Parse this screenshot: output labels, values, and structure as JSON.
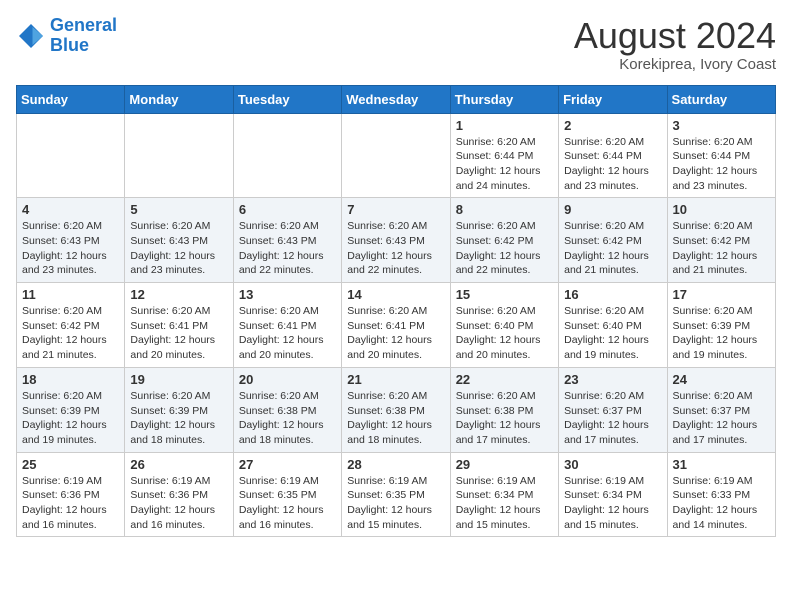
{
  "header": {
    "logo_line1": "General",
    "logo_line2": "Blue",
    "title": "August 2024",
    "subtitle": "Korekiprea, Ivory Coast"
  },
  "weekdays": [
    "Sunday",
    "Monday",
    "Tuesday",
    "Wednesday",
    "Thursday",
    "Friday",
    "Saturday"
  ],
  "weeks": [
    [
      {
        "day": "",
        "info": ""
      },
      {
        "day": "",
        "info": ""
      },
      {
        "day": "",
        "info": ""
      },
      {
        "day": "",
        "info": ""
      },
      {
        "day": "1",
        "info": "Sunrise: 6:20 AM\nSunset: 6:44 PM\nDaylight: 12 hours\nand 24 minutes."
      },
      {
        "day": "2",
        "info": "Sunrise: 6:20 AM\nSunset: 6:44 PM\nDaylight: 12 hours\nand 23 minutes."
      },
      {
        "day": "3",
        "info": "Sunrise: 6:20 AM\nSunset: 6:44 PM\nDaylight: 12 hours\nand 23 minutes."
      }
    ],
    [
      {
        "day": "4",
        "info": "Sunrise: 6:20 AM\nSunset: 6:43 PM\nDaylight: 12 hours\nand 23 minutes."
      },
      {
        "day": "5",
        "info": "Sunrise: 6:20 AM\nSunset: 6:43 PM\nDaylight: 12 hours\nand 23 minutes."
      },
      {
        "day": "6",
        "info": "Sunrise: 6:20 AM\nSunset: 6:43 PM\nDaylight: 12 hours\nand 22 minutes."
      },
      {
        "day": "7",
        "info": "Sunrise: 6:20 AM\nSunset: 6:43 PM\nDaylight: 12 hours\nand 22 minutes."
      },
      {
        "day": "8",
        "info": "Sunrise: 6:20 AM\nSunset: 6:42 PM\nDaylight: 12 hours\nand 22 minutes."
      },
      {
        "day": "9",
        "info": "Sunrise: 6:20 AM\nSunset: 6:42 PM\nDaylight: 12 hours\nand 21 minutes."
      },
      {
        "day": "10",
        "info": "Sunrise: 6:20 AM\nSunset: 6:42 PM\nDaylight: 12 hours\nand 21 minutes."
      }
    ],
    [
      {
        "day": "11",
        "info": "Sunrise: 6:20 AM\nSunset: 6:42 PM\nDaylight: 12 hours\nand 21 minutes."
      },
      {
        "day": "12",
        "info": "Sunrise: 6:20 AM\nSunset: 6:41 PM\nDaylight: 12 hours\nand 20 minutes."
      },
      {
        "day": "13",
        "info": "Sunrise: 6:20 AM\nSunset: 6:41 PM\nDaylight: 12 hours\nand 20 minutes."
      },
      {
        "day": "14",
        "info": "Sunrise: 6:20 AM\nSunset: 6:41 PM\nDaylight: 12 hours\nand 20 minutes."
      },
      {
        "day": "15",
        "info": "Sunrise: 6:20 AM\nSunset: 6:40 PM\nDaylight: 12 hours\nand 20 minutes."
      },
      {
        "day": "16",
        "info": "Sunrise: 6:20 AM\nSunset: 6:40 PM\nDaylight: 12 hours\nand 19 minutes."
      },
      {
        "day": "17",
        "info": "Sunrise: 6:20 AM\nSunset: 6:39 PM\nDaylight: 12 hours\nand 19 minutes."
      }
    ],
    [
      {
        "day": "18",
        "info": "Sunrise: 6:20 AM\nSunset: 6:39 PM\nDaylight: 12 hours\nand 19 minutes."
      },
      {
        "day": "19",
        "info": "Sunrise: 6:20 AM\nSunset: 6:39 PM\nDaylight: 12 hours\nand 18 minutes."
      },
      {
        "day": "20",
        "info": "Sunrise: 6:20 AM\nSunset: 6:38 PM\nDaylight: 12 hours\nand 18 minutes."
      },
      {
        "day": "21",
        "info": "Sunrise: 6:20 AM\nSunset: 6:38 PM\nDaylight: 12 hours\nand 18 minutes."
      },
      {
        "day": "22",
        "info": "Sunrise: 6:20 AM\nSunset: 6:38 PM\nDaylight: 12 hours\nand 17 minutes."
      },
      {
        "day": "23",
        "info": "Sunrise: 6:20 AM\nSunset: 6:37 PM\nDaylight: 12 hours\nand 17 minutes."
      },
      {
        "day": "24",
        "info": "Sunrise: 6:20 AM\nSunset: 6:37 PM\nDaylight: 12 hours\nand 17 minutes."
      }
    ],
    [
      {
        "day": "25",
        "info": "Sunrise: 6:19 AM\nSunset: 6:36 PM\nDaylight: 12 hours\nand 16 minutes."
      },
      {
        "day": "26",
        "info": "Sunrise: 6:19 AM\nSunset: 6:36 PM\nDaylight: 12 hours\nand 16 minutes."
      },
      {
        "day": "27",
        "info": "Sunrise: 6:19 AM\nSunset: 6:35 PM\nDaylight: 12 hours\nand 16 minutes."
      },
      {
        "day": "28",
        "info": "Sunrise: 6:19 AM\nSunset: 6:35 PM\nDaylight: 12 hours\nand 15 minutes."
      },
      {
        "day": "29",
        "info": "Sunrise: 6:19 AM\nSunset: 6:34 PM\nDaylight: 12 hours\nand 15 minutes."
      },
      {
        "day": "30",
        "info": "Sunrise: 6:19 AM\nSunset: 6:34 PM\nDaylight: 12 hours\nand 15 minutes."
      },
      {
        "day": "31",
        "info": "Sunrise: 6:19 AM\nSunset: 6:33 PM\nDaylight: 12 hours\nand 14 minutes."
      }
    ]
  ]
}
